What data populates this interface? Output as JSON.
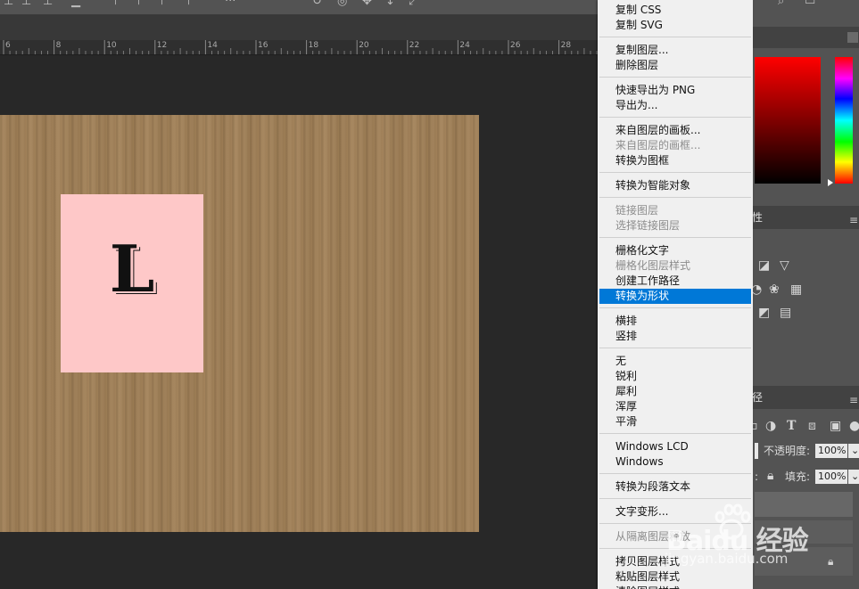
{
  "ruler": {
    "ticks": [
      "6",
      "8",
      "10",
      "12",
      "14",
      "16",
      "18",
      "20",
      "22",
      "24",
      "26",
      "28"
    ]
  },
  "canvas": {
    "card_letter": "L",
    "card_color": "#fec8c8",
    "paper_color": "#a07f56"
  },
  "context_menu": {
    "groups": [
      [
        {
          "label": "复制 CSS",
          "disabled": false
        },
        {
          "label": "复制 SVG",
          "disabled": false
        }
      ],
      [
        {
          "label": "复制图层...",
          "disabled": false
        },
        {
          "label": "删除图层",
          "disabled": false
        }
      ],
      [
        {
          "label": "快速导出为 PNG",
          "disabled": false
        },
        {
          "label": "导出为...",
          "disabled": false
        }
      ],
      [
        {
          "label": "来自图层的画板...",
          "disabled": false
        },
        {
          "label": "来自图层的画框...",
          "disabled": true
        },
        {
          "label": "转换为图框",
          "disabled": false
        }
      ],
      [
        {
          "label": "转换为智能对象",
          "disabled": false
        }
      ],
      [
        {
          "label": "链接图层",
          "disabled": true
        },
        {
          "label": "选择链接图层",
          "disabled": true
        }
      ],
      [
        {
          "label": "栅格化文字",
          "disabled": false
        },
        {
          "label": "栅格化图层样式",
          "disabled": true
        },
        {
          "label": "创建工作路径",
          "disabled": false
        },
        {
          "label": "转换为形状",
          "disabled": false,
          "selected": true
        }
      ],
      [
        {
          "label": "横排",
          "disabled": false
        },
        {
          "label": "竖排",
          "disabled": false
        }
      ],
      [
        {
          "label": "无",
          "disabled": false
        },
        {
          "label": "锐利",
          "disabled": false
        },
        {
          "label": "犀利",
          "disabled": false
        },
        {
          "label": "浑厚",
          "disabled": false
        },
        {
          "label": "平滑",
          "disabled": false
        }
      ],
      [
        {
          "label": "Windows LCD",
          "disabled": false
        },
        {
          "label": "Windows",
          "disabled": false
        }
      ],
      [
        {
          "label": "转换为段落文本",
          "disabled": false
        }
      ],
      [
        {
          "label": "文字变形...",
          "disabled": false
        }
      ],
      [
        {
          "label": "从隔离图层释放",
          "disabled": true
        }
      ],
      [
        {
          "label": "拷贝图层样式",
          "disabled": false
        },
        {
          "label": "粘贴图层样式",
          "disabled": false
        },
        {
          "label": "清除图层样式",
          "disabled": false
        }
      ]
    ],
    "highlight_color": "#0078d7"
  },
  "panels": {
    "opacity_label": "不透明度:",
    "opacity_value": "100%",
    "lock_label": "锁定:",
    "fill_label": "填充:",
    "fill_value": "100%",
    "type_icon": "T",
    "paths_tab_fragment": "径",
    "properties_tab_fragment": "性"
  },
  "watermark": {
    "brand": "Baidu 经验",
    "url": "jingyan.baidu.com"
  }
}
